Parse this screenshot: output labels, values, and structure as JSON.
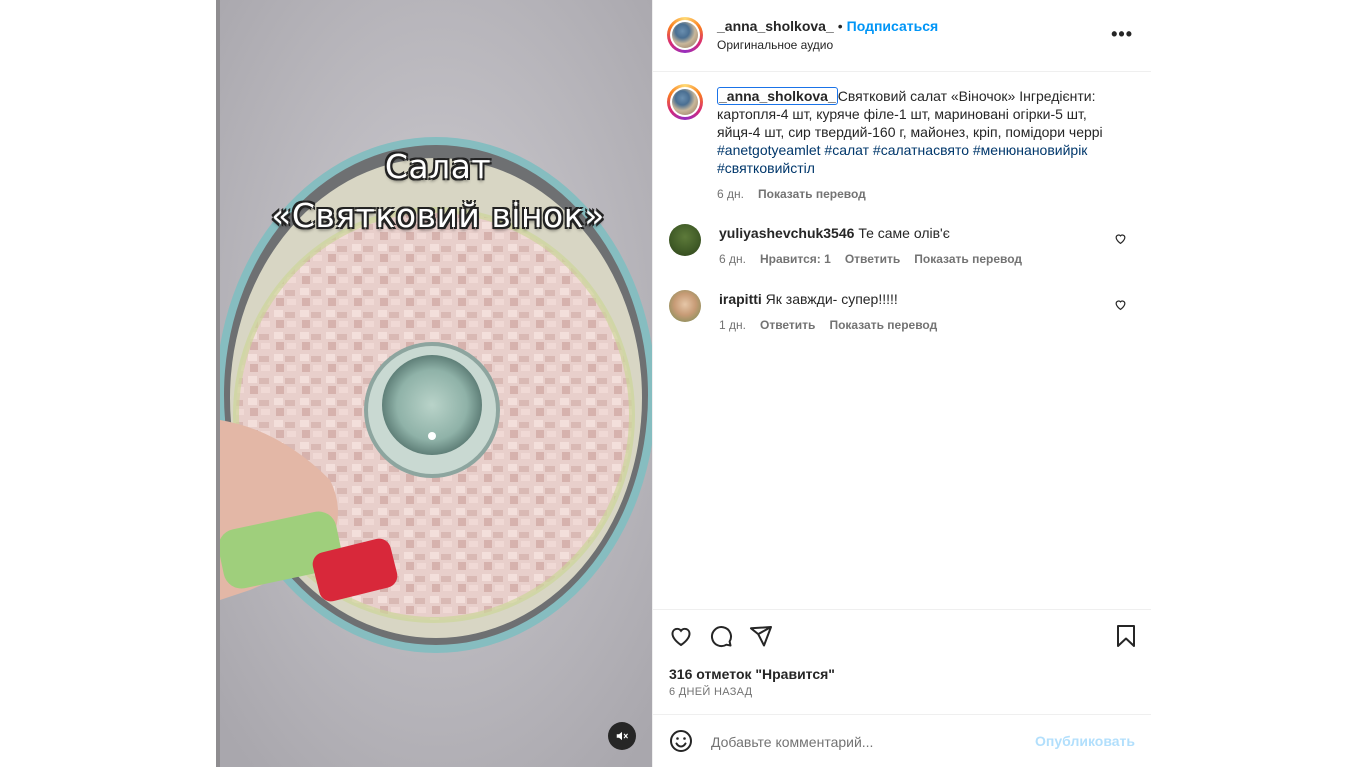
{
  "post": {
    "username": "_anna_sholkova_",
    "follow_label": "Подписаться",
    "separator": "•",
    "audio_label": "Оригинальное аудио",
    "more_label": "•••"
  },
  "video": {
    "title_line1": "Салат",
    "title_line2": "«Святковий вінок»",
    "mute_icon": "speaker-muted-icon"
  },
  "caption": {
    "username": "_anna_sholkova_",
    "text": "Святковий салат «Віночок» Інгредієнти: картопля-4 шт, куряче філе-1 шт, мариновані огірки-5 шт, яйця-4 шт, сир твердий-160 г, майонез, кріп, помідори черрі ",
    "hashtags": "#anetgotyeamlet #салат #салатнасвято #менюнановийрік #святковийстіл",
    "age": "6 дн.",
    "translate_label": "Показать перевод"
  },
  "comments": [
    {
      "username": "yuliyashevchuk3546",
      "text": "Те саме олів'є",
      "age": "6 дн.",
      "likes_label": "Нравится: 1",
      "reply_label": "Ответить",
      "translate_label": "Показать перевод"
    },
    {
      "username": "irapitti",
      "text": "Як завжди- супер!!!!!",
      "age": "1 дн.",
      "reply_label": "Ответить",
      "translate_label": "Показать перевод"
    }
  ],
  "actions": {
    "like_icon": "heart-icon",
    "comment_icon": "comment-icon",
    "share_icon": "send-icon",
    "save_icon": "bookmark-icon",
    "likes_count": "316 отметок \"Нравится\"",
    "posted_ago": "6 ДНЕЙ НАЗАД"
  },
  "comment_box": {
    "placeholder": "Добавьте комментарий...",
    "value": "",
    "post_label": "Опубликовать"
  },
  "colors": {
    "accent": "#0095f6",
    "post_disabled": "#b2dffc",
    "hashtag": "#00376b",
    "muted_text": "#737373"
  }
}
